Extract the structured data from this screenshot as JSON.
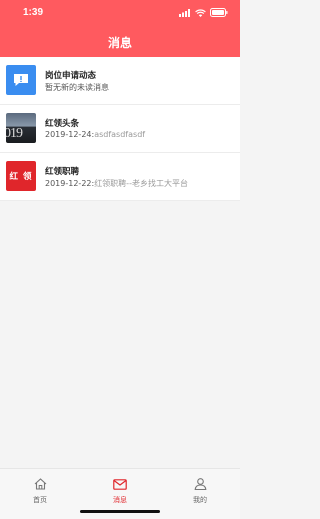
{
  "status": {
    "time": "1:39"
  },
  "header": {
    "title": "消息"
  },
  "messages": [
    {
      "title": "岗位申请动态",
      "subtitle": "暂无新的未读消息",
      "date": "",
      "icon": "alert-message-icon"
    },
    {
      "title": "红领头条",
      "date": "2019-12-24:",
      "subtitle": "asdfasdfasdf",
      "icon": "news-photo-thumbnail",
      "thumb_text": "019"
    },
    {
      "title": "红领职聘",
      "date": "2019-12-22:",
      "subtitle": "红领职聘--老乡找工大平台",
      "icon": "hongling-logo",
      "thumb_text": "红 领"
    }
  ],
  "tabbar": {
    "items": [
      {
        "label": "首页",
        "icon": "home-icon",
        "active": false
      },
      {
        "label": "消息",
        "icon": "mail-icon",
        "active": true
      },
      {
        "label": "我的",
        "icon": "person-icon",
        "active": false
      }
    ]
  },
  "colors": {
    "header": "#ff5a5f",
    "accent": "#e0262b",
    "app_icon": "#3a8df0"
  }
}
